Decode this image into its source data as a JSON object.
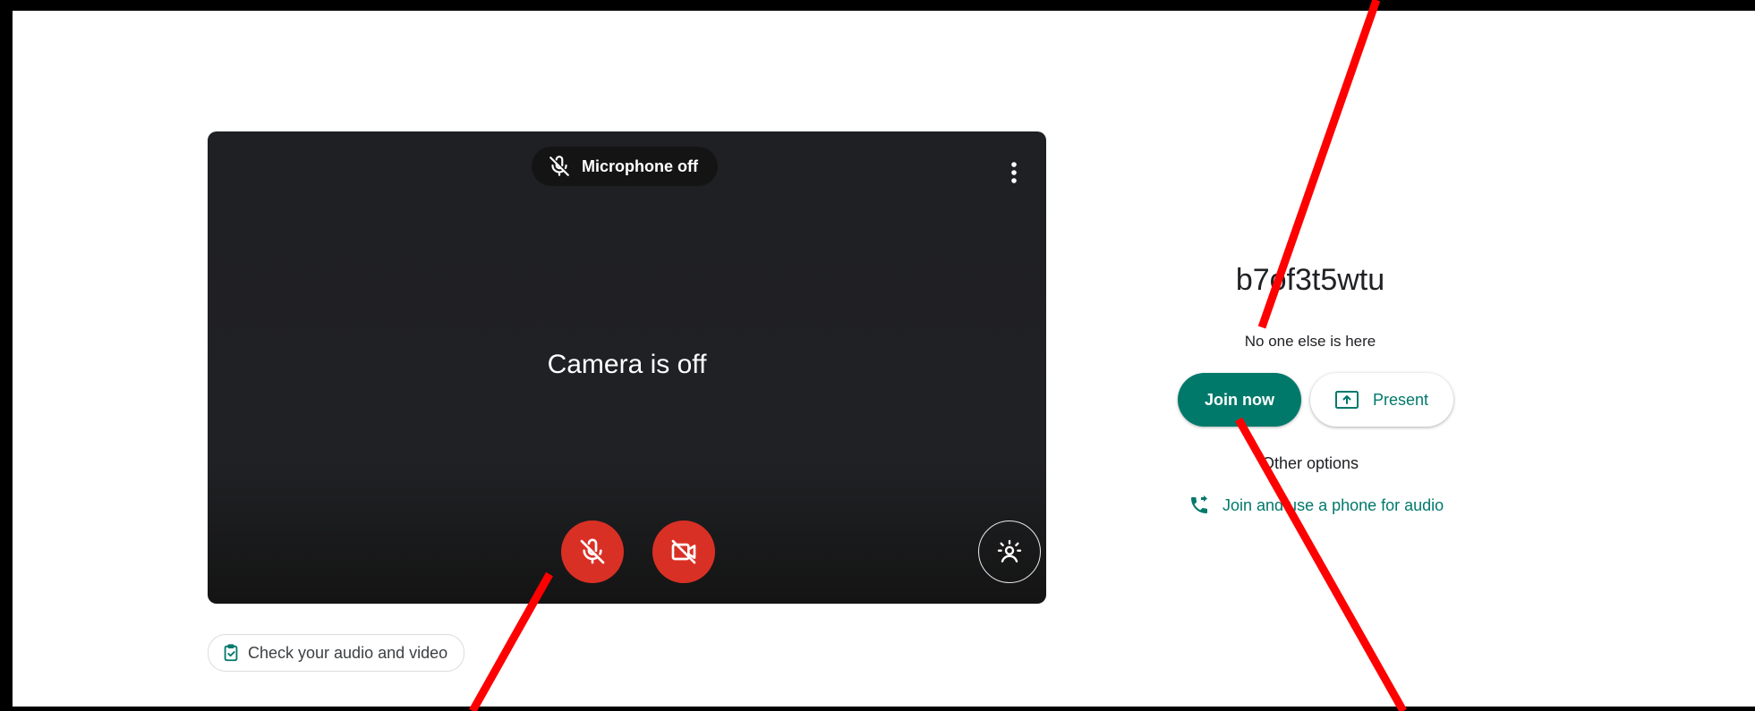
{
  "preview": {
    "mic_status": "Microphone off",
    "camera_status": "Camera is off"
  },
  "controls": {
    "mic_icon": "mic-off-icon",
    "camera_icon": "videocam-off-icon",
    "effects_icon": "visual-effects-icon",
    "more_icon": "more-vert-icon"
  },
  "check": {
    "label": "Check your audio and video"
  },
  "meeting": {
    "code": "b7of3t5wtu",
    "status": "No one else is here"
  },
  "actions": {
    "join_label": "Join now",
    "present_label": "Present",
    "other_options": "Other options",
    "phone_label": "Join and use a phone for audio"
  },
  "colors": {
    "accent": "#00796b",
    "danger": "#d93025",
    "annotation": "#ff0000"
  }
}
